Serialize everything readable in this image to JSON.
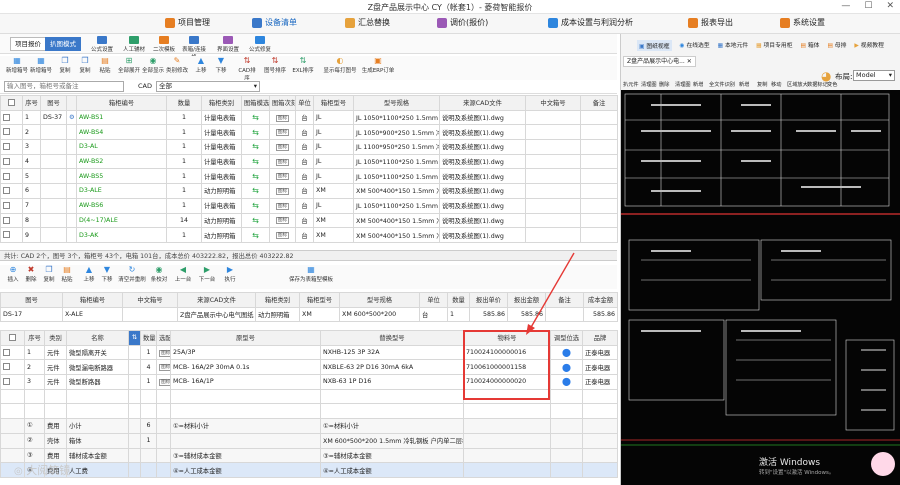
{
  "window_title": "Z盘产品展示中心 CY（帐套1）- 菱荷智能报价",
  "win_controls": [
    "—",
    "☐",
    "✕"
  ],
  "menu": [
    {
      "label": "项目管理",
      "color": "#e67e22"
    },
    {
      "label": "设备清单",
      "color": "#3a78c9",
      "active": true
    },
    {
      "label": "汇总替换",
      "color": "#e6a23c"
    },
    {
      "label": "调价(报价)",
      "color": "#9b59b6"
    },
    {
      "label": "成本设置与利润分析",
      "color": "#2e86de"
    },
    {
      "label": "报表导出",
      "color": "#e67e22"
    },
    {
      "label": "系统设置",
      "color": "#e67e22"
    }
  ],
  "ribbon": {
    "tabs": [
      "项目报价",
      "扒图模式"
    ],
    "items": [
      "公式设置",
      "人工辅材",
      "二次模板",
      "表箱/连接格",
      "界面设置",
      "公式修复"
    ]
  },
  "toolbar1": [
    "新增箱号",
    "新增箱号",
    "复制",
    "复制",
    "粘贴",
    "全部展开",
    "全部显示",
    "类别修改",
    "上移",
    "下移",
    "CAD排序",
    "图号排序",
    "EXL排序",
    "显示每打图号",
    "生成ERP订单"
  ],
  "filter": {
    "placeholder": "输入图号，箱柜号或备注",
    "cad_label": "CAD",
    "cad_value": "全部"
  },
  "top_table": {
    "headers": [
      "",
      "序号",
      "图号",
      "",
      "箱柜编号",
      "数量",
      "箱柜类别",
      "图箱模选",
      "图箱次刻",
      "单位",
      "箱柜型号",
      "型号规格",
      "来源CAD文件",
      "中文箱号",
      "备注"
    ],
    "rows": [
      {
        "seq": "1",
        "drawing": "DS-37",
        "code": "AW-BS1",
        "qty": "1",
        "cat": "计量电表箱",
        "unit": "台",
        "model": "JL",
        "spec": "JL 1050*1100*250 1.5mm 冷轧",
        "src": "说明及系统图(1).dwg"
      },
      {
        "seq": "2",
        "drawing": "",
        "code": "AW-BS4",
        "qty": "1",
        "cat": "计量电表箱",
        "unit": "台",
        "model": "JL",
        "spec": "JL 1050*900*250 1.5mm 冷轧",
        "src": "说明及系统图(1).dwg"
      },
      {
        "seq": "3",
        "drawing": "",
        "code": "D3-AL",
        "qty": "1",
        "cat": "计量电表箱",
        "unit": "台",
        "model": "JL",
        "spec": "JL 1100*950*250 1.5mm 冷轧",
        "src": "说明及系统图(1).dwg"
      },
      {
        "seq": "4",
        "drawing": "",
        "code": "AW-BS2",
        "qty": "1",
        "cat": "计量电表箱",
        "unit": "台",
        "model": "JL",
        "spec": "JL 1050*1100*250 1.5mm 冷轧",
        "src": "说明及系统图(1).dwg"
      },
      {
        "seq": "5",
        "drawing": "",
        "code": "AW-BS5",
        "qty": "1",
        "cat": "计量电表箱",
        "unit": "台",
        "model": "JL",
        "spec": "JL 1050*1100*250 1.5mm 冷轧",
        "src": "说明及系统图(1).dwg"
      },
      {
        "seq": "6",
        "drawing": "",
        "code": "D3-ALE",
        "qty": "1",
        "cat": "动力照明箱",
        "unit": "台",
        "model": "XM",
        "spec": "XM 500*400*150 1.5mm 冷轧",
        "src": "说明及系统图(1).dwg"
      },
      {
        "seq": "7",
        "drawing": "",
        "code": "AW-BS6",
        "qty": "1",
        "cat": "计量电表箱",
        "unit": "台",
        "model": "JL",
        "spec": "JL 1050*1100*250 1.5mm 冷轧",
        "src": "说明及系统图(1).dwg"
      },
      {
        "seq": "8",
        "drawing": "",
        "code": "D(4~17)ALE",
        "qty": "14",
        "cat": "动力照明箱",
        "unit": "台",
        "model": "XM",
        "spec": "XM 500*400*150 1.5mm 冷轧",
        "src": "说明及系统图(1).dwg"
      },
      {
        "seq": "9",
        "drawing": "",
        "code": "D3-AK",
        "qty": "1",
        "cat": "动力照明箱",
        "unit": "台",
        "model": "XM",
        "spec": "XM 500*400*150 1.5mm 冷轧",
        "src": "说明及系统图(1).dwg"
      }
    ],
    "tag": "图标"
  },
  "status_top": "共计: CAD 2个，图号 3个，箱柜号 43个，电箱 101台，成本总价 403222.82，报出总价 403222.82",
  "toolbar2": [
    "插入",
    "删除",
    "复制",
    "粘贴",
    "上移",
    "下移",
    "清空并重刷",
    "条校对",
    "上一台",
    "下一台",
    "执行",
    "保存为表箱型模板"
  ],
  "detail_header": {
    "headers": [
      "图号",
      "箱柜编号",
      "中文箱号",
      "来源CAD文件",
      "箱柜类别",
      "箱柜型号",
      "型号规格",
      "单位",
      "数量",
      "报出单价",
      "报出金额",
      "备注",
      "成本金额"
    ],
    "row": [
      "DS-17",
      "X-ALE",
      "",
      "Z盘产品展示中心电气图纸",
      "动力照明箱",
      "XM",
      "XM 600*500*200",
      "台",
      "1",
      "585.86",
      "585.86",
      "",
      "585.86"
    ]
  },
  "bottom_table": {
    "headers": [
      "",
      "序号",
      "类别",
      "名称",
      "",
      "数量",
      "选配",
      "原型号",
      "替换型号",
      "物料号",
      "调型位选",
      "品牌"
    ],
    "rows": [
      {
        "seq": "1",
        "cat": "元件",
        "name": "微型隔离开关",
        "qty": "1",
        "model": "25A/3P",
        "rep": "NXHB-125 3P 32A",
        "mat": "710024100000016",
        "brand": "正泰电器"
      },
      {
        "seq": "2",
        "cat": "元件",
        "name": "微型漏电断路器",
        "qty": "4",
        "model": "MCB- 16A/2P 30mA 0.1s",
        "rep": "NXBLE-63 2P D16 30mA 6kA",
        "mat": "710061000001158",
        "brand": "正泰电器"
      },
      {
        "seq": "3",
        "cat": "元件",
        "name": "微型断路器",
        "qty": "1",
        "model": "MCB- 16A/1P",
        "rep": "NXB-63 1P D16",
        "mat": "710024000000020",
        "brand": "正泰电器"
      },
      {
        "seq": "",
        "cat": "",
        "name": "",
        "qty": "",
        "model": "",
        "rep": "",
        "mat": "",
        "brand": ""
      },
      {
        "seq": "",
        "cat": "",
        "name": "",
        "qty": "",
        "model": "",
        "rep": "",
        "mat": "",
        "brand": ""
      },
      {
        "seq": "①",
        "cat": "费用",
        "name": "小计",
        "qty": "6",
        "model": "①=材料小计",
        "rep": "①=材料小计",
        "mat": "",
        "brand": ""
      },
      {
        "seq": "②",
        "cat": "壳体",
        "name": "箱体",
        "qty": "1",
        "model": "",
        "rep": "XM 600*500*200 1.5mm 冷轧钢板 户内单二层板",
        "mat": "",
        "brand": ""
      },
      {
        "seq": "③",
        "cat": "费用",
        "name": "辅材成本金额",
        "qty": "",
        "model": "③=辅材成本金额",
        "rep": "③=辅材成本金额",
        "mat": "",
        "brand": ""
      },
      {
        "seq": "④",
        "cat": "费用",
        "name": "人工费",
        "qty": "",
        "model": "④=人工成本金额",
        "rep": "④=人工成本金额",
        "mat": "",
        "brand": ""
      }
    ]
  },
  "right_pane": {
    "toolbar_top": [
      "图纸视框",
      "在线选型",
      "本地元件",
      "项目专用柜",
      "箱体",
      "母排",
      "视频教程"
    ],
    "doc_tab": "Z盘产品展示中心电...",
    "toolbar2": [
      "扒元件",
      "清理图",
      "删除",
      "清理图",
      "新增",
      "全文件识别",
      "新增",
      "复制",
      "移动",
      "区域放大",
      "数据标记",
      "变色"
    ],
    "layout_label": "布局:",
    "layout_value": "Model",
    "activate": "激活 Windows",
    "activate_sub": "转到\"设置\"以激活 Windows。"
  },
  "watermark": "大阅筑镜"
}
